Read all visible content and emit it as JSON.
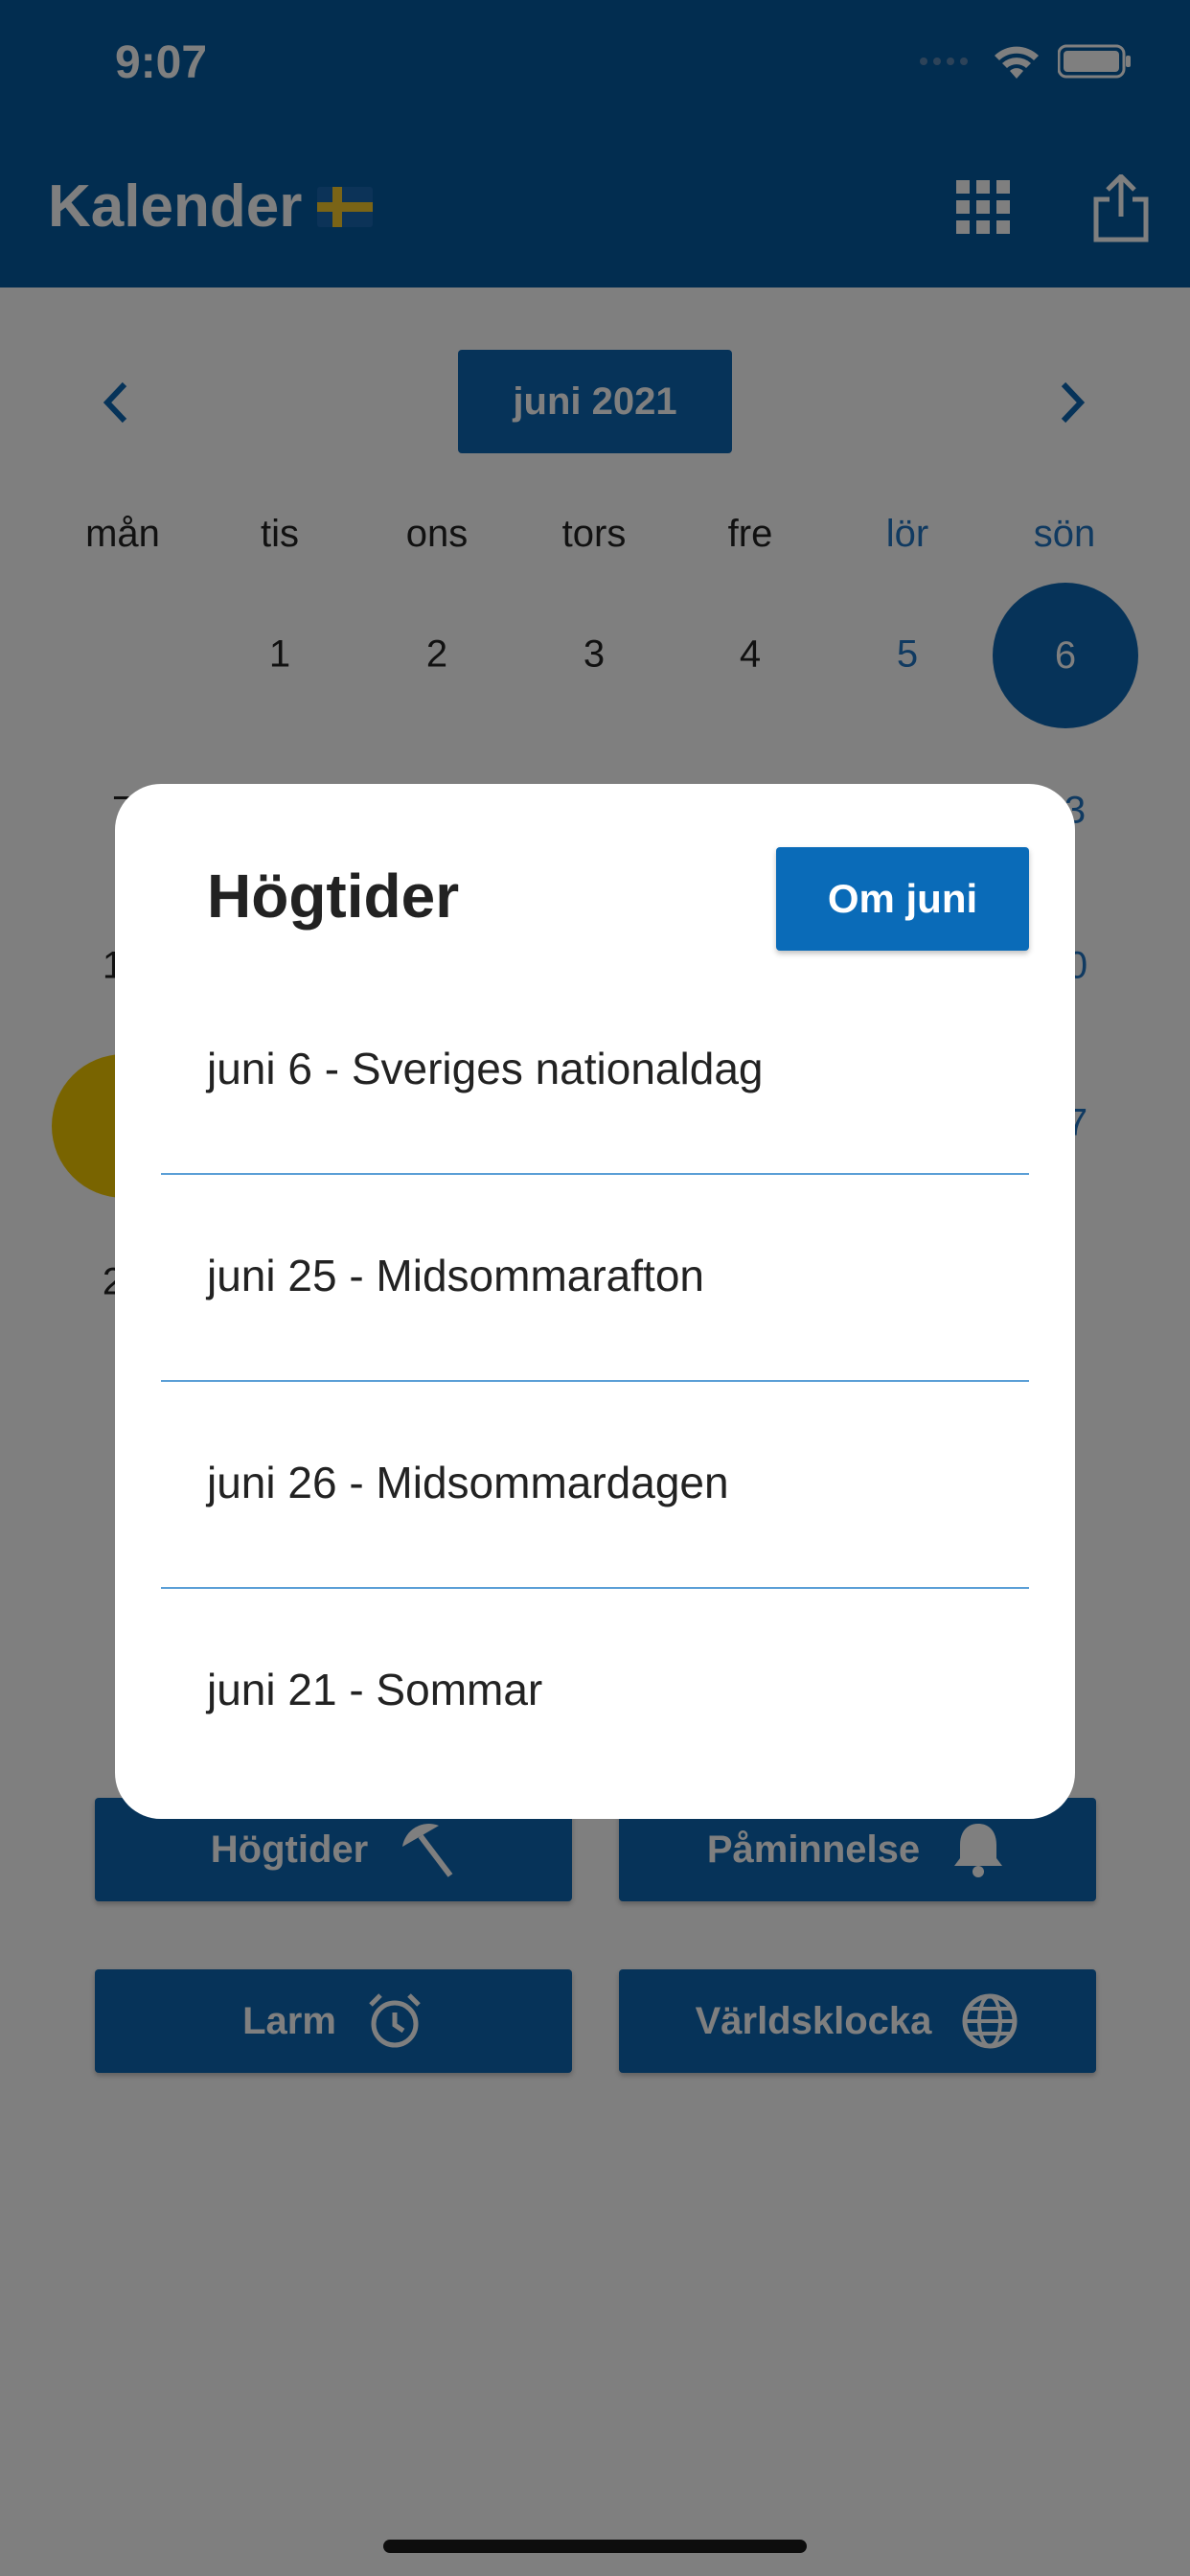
{
  "status_bar": {
    "time": "9:07"
  },
  "header": {
    "title": "Kalender",
    "flag_icon": "swedish-flag-icon",
    "grid_icon": "grid-icon",
    "share_icon": "share-icon"
  },
  "calendar": {
    "month_label": "juni 2021",
    "weekdays": [
      "mån",
      "tis",
      "ons",
      "tors",
      "fre",
      "lör",
      "sön"
    ],
    "visible_days_row1": [
      "1",
      "2",
      "3",
      "4",
      "5",
      "6"
    ],
    "partial_days_left": [
      "7",
      "1",
      "2"
    ],
    "partial_days_right": [
      "3",
      "0",
      "7"
    ],
    "selected_day": "6"
  },
  "buttons": {
    "hogtider": "Högtider",
    "paminnelse": "Påminnelse",
    "larm": "Larm",
    "varldsklocka": "Världsklocka"
  },
  "modal": {
    "title": "Högtider",
    "om_button": "Om juni",
    "holidays": [
      "juni 6 - Sveriges nationaldag",
      "juni 25 - Midsommarafton",
      "juni 26 - Midsommardagen",
      "juni 21 - Sommar"
    ]
  },
  "colors": {
    "header_blue": "#045ba0",
    "button_blue": "#0d66b2",
    "weekend_blue": "#2074c2",
    "highlight_yellow": "#f3c800"
  }
}
